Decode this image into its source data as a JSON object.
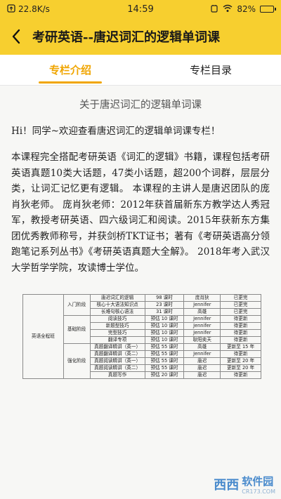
{
  "status_bar": {
    "network_speed": "22.8K/s",
    "time": "14:59",
    "battery_percent": "82%",
    "battery_level": 0.82
  },
  "header": {
    "title": "考研英语--唐迟词汇的逻辑单词课"
  },
  "tabs": [
    {
      "label": "专栏介绍",
      "active": true
    },
    {
      "label": "专栏目录",
      "active": false
    }
  ],
  "article": {
    "title": "关于唐迟词汇的逻辑单词课",
    "greeting": "Hi！同学~欢迎查看唐迟词汇的逻辑单词课专栏！",
    "body": "本课程完全搭配考研英语《词汇的逻辑》书籍，课程包括考研英语真题10类大话题，47类小话题，超200个词群，层层分类，让词汇记忆更有逻辑。 本课程的主讲人是唐迟团队的庞肖狄老师。 庞肖狄老师：2012年获首届新东方教学达人秀冠军，教授考研英语、四六级词汇和阅读。2015年获新东方集团优秀教师称号，并获剑桥TKT证书；著有《考研英语高分领跑笔记系列丛书》《考研英语真题大全解》。 2018年考入武汉大学哲学学院，攻读博士学位。"
  },
  "course_table": {
    "class_name": "英语全程班",
    "stages": [
      {
        "name": "入门阶段",
        "rows": [
          {
            "course": "唐迟词汇的逻辑",
            "hours": "98 课时",
            "teacher": "庞肖狄",
            "status": "已更完"
          },
          {
            "course": "核心十大语法知识点",
            "hours": "23 课时",
            "teacher": "Jennifer",
            "status": "已更完"
          },
          {
            "course": "长难句核心语法",
            "hours": "31 课时",
            "teacher": "高雄",
            "status": "已更完"
          }
        ]
      },
      {
        "name": "基础阶段",
        "rows": [
          {
            "course": "阅读技巧",
            "hours": "预估 10 课时",
            "teacher": "Jennifer",
            "status": "待更新"
          },
          {
            "course": "新题型技巧",
            "hours": "预估 10 课时",
            "teacher": "Jennifer",
            "status": "待更新"
          },
          {
            "course": "完型技巧",
            "hours": "预估 10 课时",
            "teacher": "Jennifer",
            "status": "待更新"
          },
          {
            "course": "翻译专项",
            "hours": "预估 10 课时",
            "teacher": "耿阳奕天",
            "status": "待更新"
          }
        ]
      },
      {
        "name": "强化阶段",
        "rows": [
          {
            "course": "真题翻译精讲（英一）",
            "hours": "预估 55 课时",
            "teacher": "高雄",
            "status": "更新至 15 年"
          },
          {
            "course": "真题翻译精讲（英二）",
            "hours": "预估 55 课时",
            "teacher": "Jennifer",
            "status": "待更新"
          },
          {
            "course": "真题阅读精讲（英一）",
            "hours": "预估 55 课时",
            "teacher": "唐迟",
            "status": "更新至 20 年"
          },
          {
            "course": "真题阅读精讲（英二）",
            "hours": "预估 55 课时",
            "teacher": "唐迟",
            "status": "更新至 20 年"
          },
          {
            "course": "真题写作",
            "hours": "预估 20 课时",
            "teacher": "唐迟",
            "status": "待更新"
          }
        ]
      }
    ]
  },
  "watermark": {
    "logo_text": "西西",
    "site_name": "软件园",
    "site_url": "CR173.COM"
  },
  "colors": {
    "header_bg": "#f7cf2f",
    "tab_active": "#f0a500",
    "page_bg": "#f7f7f5"
  }
}
